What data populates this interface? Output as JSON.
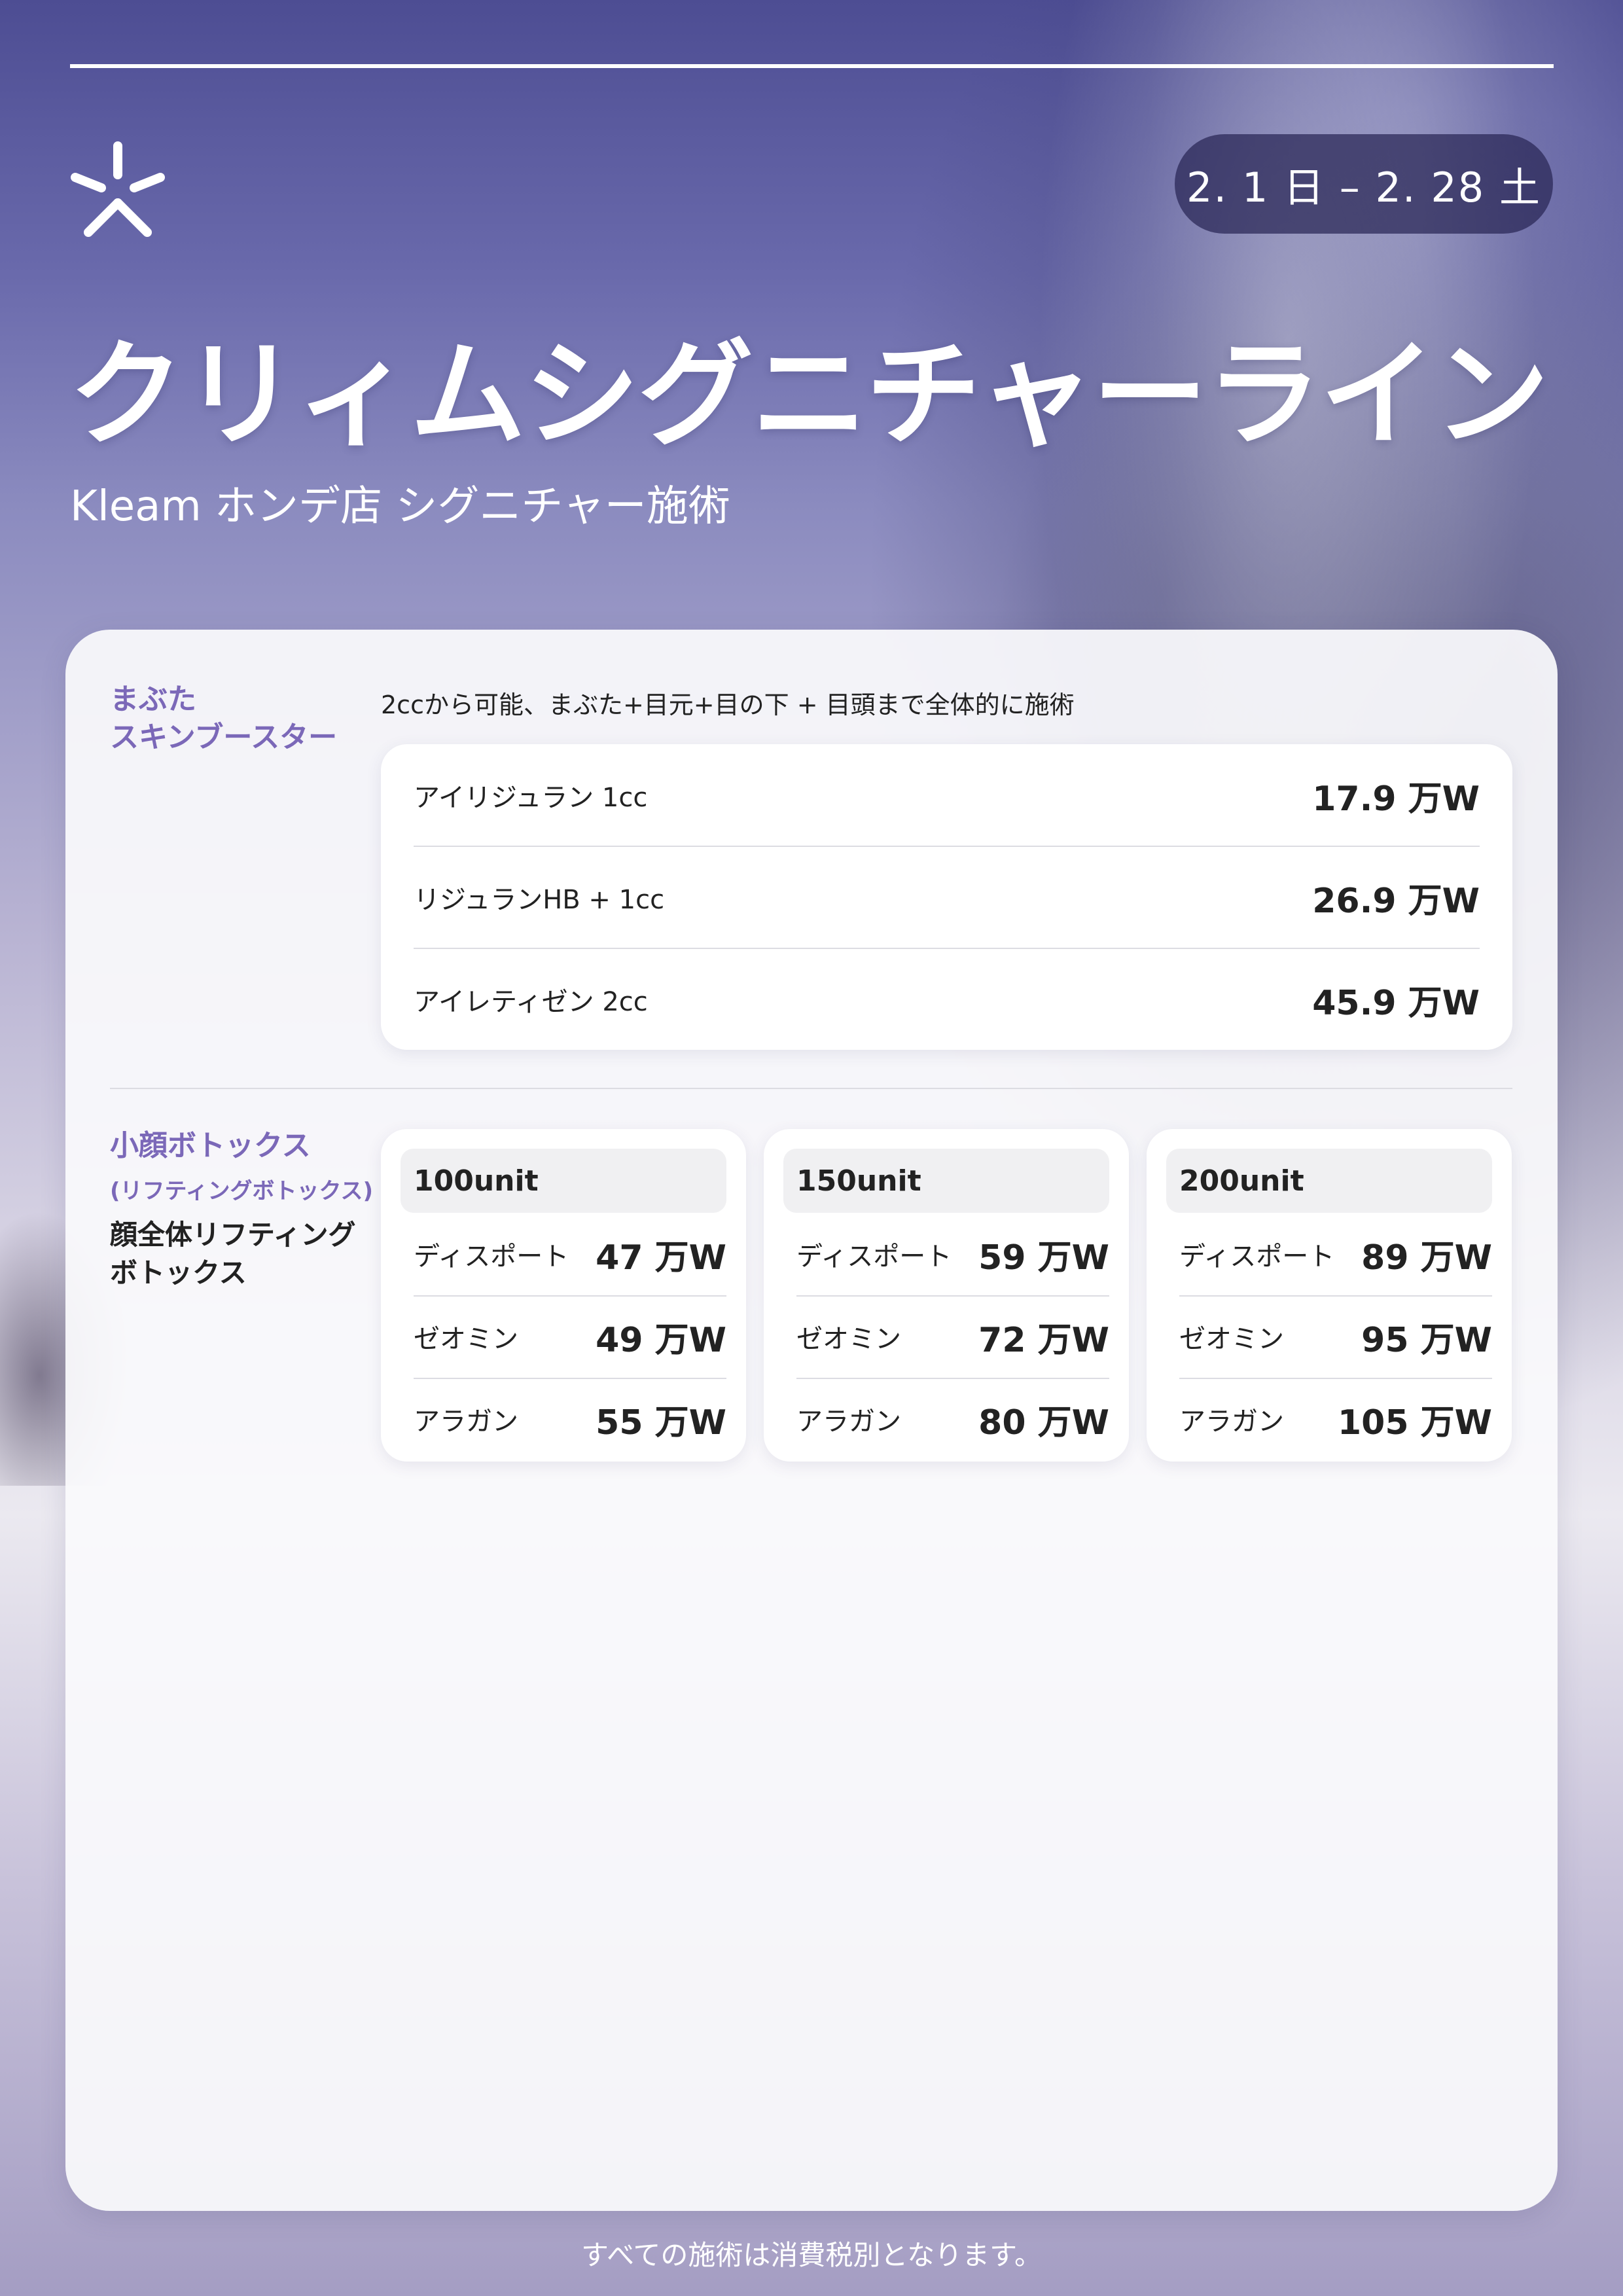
{
  "header": {
    "date_range": "2. 1 日 – 2. 28 土",
    "title": "クリィムシグニチャーライン",
    "subtitle": "Kleam ホンデ店 シグニチャー施術"
  },
  "section1": {
    "label_line1": "まぶた",
    "label_line2": "スキンブースター",
    "description": "2ccから可能、まぶた+目元+目の下 + 目頭まで全体的に施術",
    "items": [
      {
        "name": "アイリジュラン 1cc",
        "price": "17.9 万W"
      },
      {
        "name": "リジュランHB + 1cc",
        "price": "26.9 万W"
      },
      {
        "name": "アイレティゼン 2cc",
        "price": "45.9 万W"
      }
    ]
  },
  "section2": {
    "label": "小顔ボトックス",
    "sublabel": "(リフティングボトックス)",
    "desc_line1": "顔全体リフティング",
    "desc_line2": "ボトックス",
    "panels": [
      {
        "unit": "100unit",
        "rows": [
          {
            "name": "ディスポート",
            "price": "47 万W"
          },
          {
            "name": "ゼオミン",
            "price": "49 万W"
          },
          {
            "name": "アラガン",
            "price": "55 万W"
          }
        ]
      },
      {
        "unit": "150unit",
        "rows": [
          {
            "name": "ディスポート",
            "price": "59 万W"
          },
          {
            "name": "ゼオミン",
            "price": "72 万W"
          },
          {
            "name": "アラガン",
            "price": "80 万W"
          }
        ]
      },
      {
        "unit": "200unit",
        "rows": [
          {
            "name": "ディスポート",
            "price": "89 万W"
          },
          {
            "name": "ゼオミン",
            "price": "95 万W"
          },
          {
            "name": "アラガン",
            "price": "105 万W"
          }
        ]
      }
    ]
  },
  "footer": {
    "note": "すべての施術は消費税別となります。"
  },
  "colors": {
    "accent": "#7b68b8",
    "pill_bg": "#28265a",
    "text": "#222222"
  },
  "icons": {
    "logo": "snowflake-burst-icon"
  }
}
